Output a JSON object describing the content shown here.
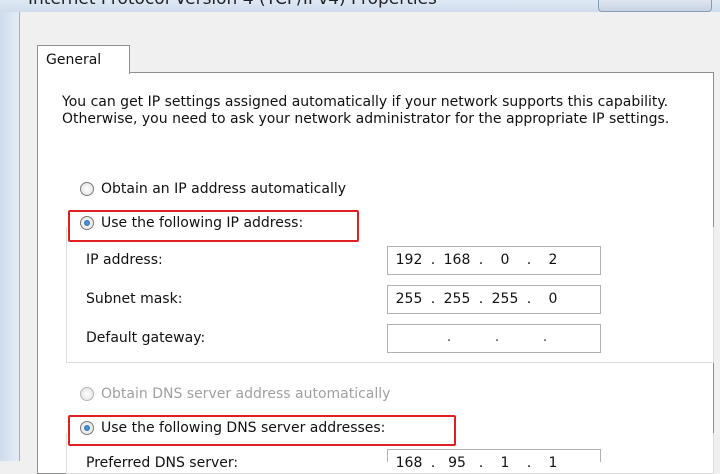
{
  "window": {
    "title": "Internet Protocol Version 4 (TCP/IPv4) Properties"
  },
  "tabs": [
    {
      "label": "General",
      "selected": true
    }
  ],
  "description": "You can get IP settings assigned automatically if your network supports this capability. Otherwise, you need to ask your network administrator for the appropriate IP settings.",
  "ip_options": {
    "auto_label": "Obtain an IP address automatically",
    "manual_label": "Use the following IP address:",
    "selected": "manual"
  },
  "ip_fields": [
    {
      "label": "IP address:",
      "octets": [
        "192",
        "168",
        "0",
        "2"
      ]
    },
    {
      "label": "Subnet mask:",
      "octets": [
        "255",
        "255",
        "255",
        "0"
      ]
    },
    {
      "label": "Default gateway:",
      "octets": [
        "",
        "",
        "",
        ""
      ]
    }
  ],
  "dns_options": {
    "auto_label": "Obtain DNS server address automatically",
    "manual_label": "Use the following DNS server addresses:",
    "selected": "manual"
  },
  "dns_fields": [
    {
      "label": "Preferred DNS server:",
      "octets": [
        "168",
        "95",
        "1",
        "1"
      ]
    }
  ],
  "highlight_color": "#e02020"
}
